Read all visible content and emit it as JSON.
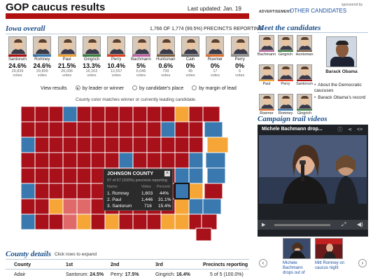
{
  "header": {
    "title": "GOP caucus results",
    "updated": "Last updated: Jan. 19",
    "advertisement": "ADVERTISEMENT",
    "other_candidates": "OTHER CANDIDATES",
    "sponsored": "sponsored by"
  },
  "iowa": {
    "title": "Iowa overall",
    "precincts": "1,766 OF 1,774 (99.5%) PRECINCTS REPORTING",
    "candidates": [
      {
        "name": "Santorum",
        "pct": "24.6%",
        "votes": "29,839",
        "votes_label": "votes",
        "color": "#b01010"
      },
      {
        "name": "Romney",
        "pct": "24.6%",
        "votes": "29,805",
        "votes_label": "votes",
        "color": "#3a78b0"
      },
      {
        "name": "Paul",
        "pct": "21.5%",
        "votes": "26,036",
        "votes_label": "votes",
        "color": "#f0a030"
      },
      {
        "name": "Gingrich",
        "pct": "13.3%",
        "votes": "16,163",
        "votes_label": "votes",
        "color": "#3a8040"
      },
      {
        "name": "Perry",
        "pct": "10.4%",
        "votes": "12,557",
        "votes_label": "votes",
        "color": "#e04020"
      },
      {
        "name": "Bachmann",
        "pct": "5%",
        "votes": "6,046",
        "votes_label": "votes",
        "color": "#c060a0"
      },
      {
        "name": "Huntsman",
        "pct": "0.6%",
        "votes": "739",
        "votes_label": "votes",
        "color": "#806040"
      },
      {
        "name": "Cain",
        "pct": "0%",
        "votes": "45",
        "votes_label": "votes",
        "color": "#707070"
      },
      {
        "name": "Roemer",
        "pct": "0%",
        "votes": "17",
        "votes_label": "votes",
        "color": "#e07030"
      },
      {
        "name": "Perry",
        "pct": "0%",
        "votes": "6",
        "votes_label": "votes",
        "color": "#909090"
      }
    ],
    "view_label": "View results",
    "view_options": [
      "by leader or winner",
      "by candidate's place",
      "by margin of lead"
    ],
    "map_note": "County color matches winner or currently leading candidate."
  },
  "map_colors": {
    "santorum": "#a8101a",
    "romney": "#3a78b0",
    "paul": "#f5a637",
    "tie": "#e06a6a",
    "selected": "#3a78b0"
  },
  "tooltip": {
    "county": "JOHNSON COUNTY",
    "close": "×",
    "precincts": "57 of 57 (100%) precincts reporting",
    "headers": [
      "Name",
      "Votes",
      "Percent"
    ],
    "rows": [
      {
        "name": "1. Romney",
        "votes": "1,603",
        "pct": "44%"
      },
      {
        "name": "2. Paul",
        "votes": "1,446",
        "pct": "31.1%"
      },
      {
        "name": "3. Santorum",
        "votes": "716",
        "pct": "15.4%"
      }
    ]
  },
  "county_details": {
    "title": "County details",
    "hint": "Click rows to expand",
    "headers": [
      "County",
      "1st",
      "2nd",
      "3rd",
      "Precincts reporting"
    ],
    "rows": [
      {
        "county": "Adair",
        "first_name": "Santorum:",
        "first_pct": "24.5%",
        "second_name": "Perry:",
        "second_pct": "17.5%",
        "third_name": "Gingrich:",
        "third_pct": "16.4%",
        "precincts": "5 of 5 (100.0%)"
      }
    ]
  },
  "meet": {
    "title": "Meet the candidates",
    "candidates": [
      {
        "name": "Bachmann",
        "color": "#c060a0"
      },
      {
        "name": "Gingrich",
        "color": "#3a8040"
      },
      {
        "name": "Huntsman",
        "color": "#806040"
      },
      {
        "name": "Paul",
        "color": "#f0a030"
      },
      {
        "name": "Perry",
        "color": "#e04020"
      },
      {
        "name": "Santorum",
        "color": "#b01010"
      },
      {
        "name": "Roemer",
        "color": "#e07030"
      },
      {
        "name": "Romney",
        "color": "#3a78b0"
      },
      {
        "name": "Gingrich",
        "color": "#3a8040"
      }
    ],
    "obama": {
      "name": "Barack Obama",
      "links": [
        "About the Democratic caucuses",
        "Barack Obama's record"
      ]
    }
  },
  "videos": {
    "title": "Campaign trail videos",
    "player_title": "Michele Bachmann drop...",
    "thumbs": [
      {
        "caption": "Michele Bachmann drops out of"
      },
      {
        "caption": "Mitt Romney on caucus night"
      }
    ]
  }
}
